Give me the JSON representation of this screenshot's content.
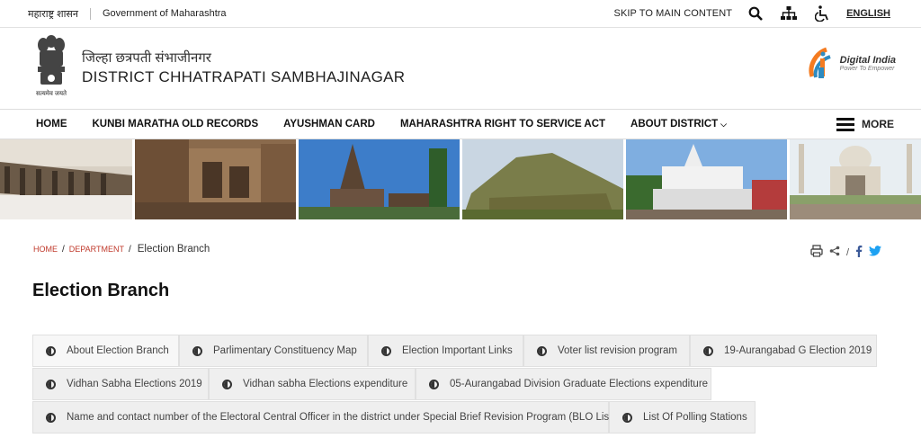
{
  "topbar": {
    "state_govt_hi": "महाराष्ट्र शासन",
    "state_govt_en": "Government of Maharashtra",
    "skip": "SKIP TO MAIN CONTENT",
    "language": "ENGLISH"
  },
  "header": {
    "title_hi": "जिल्हा छत्रपती संभाजीनगर",
    "title_en": "DISTRICT CHHATRAPATI SAMBHAJINAGAR",
    "emblem_motto": "सत्यमेव जयते",
    "digital_india": "Digital India",
    "digital_india_tag": "Power To Empower"
  },
  "nav": {
    "items": [
      "HOME",
      "KUNBI MARATHA OLD RECORDS",
      "AYUSHMAN CARD",
      "MAHARASHTRA RIGHT TO SERVICE ACT",
      "ABOUT DISTRICT"
    ],
    "more": "MORE"
  },
  "breadcrumb": {
    "home": "HOME",
    "department": "DEPARTMENT",
    "current": "Election Branch"
  },
  "page_title": "Election Branch",
  "tabs": [
    "About Election Branch",
    "Parlimentary Constituency Map",
    "Election Important Links",
    "Voter list revision program",
    "19-Aurangabad G Election 2019",
    "Vidhan Sabha Elections 2019",
    "Vidhan sabha Elections expenditure",
    "05-Aurangabad Division Graduate Elections expenditure",
    "Name and contact number of the Electoral Central Officer in the district under Special Brief Revision Program (BLO List)",
    "List Of Polling Stations"
  ],
  "colors": {
    "link_red": "#c0392b",
    "twitter": "#1da1f2",
    "facebook": "#3b5998"
  }
}
